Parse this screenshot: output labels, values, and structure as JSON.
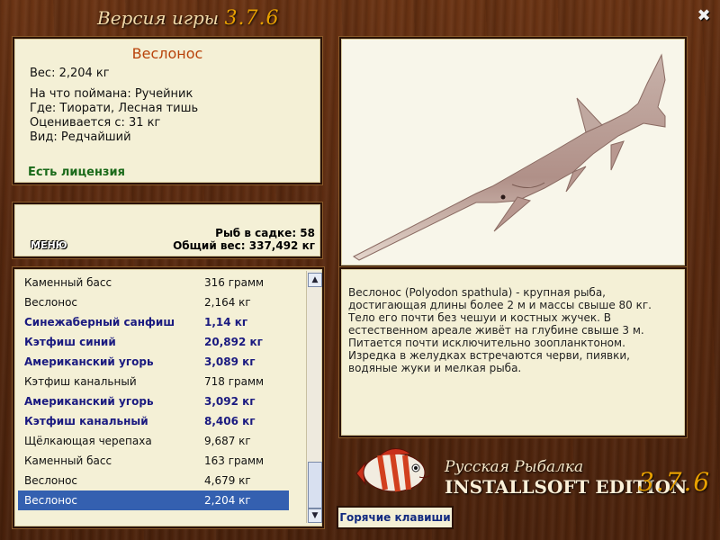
{
  "header": {
    "title_prefix": "Версия игры",
    "version": "3.7.6",
    "close_glyph": "✖"
  },
  "fish_info": {
    "name": "Веслонос",
    "weight": "Вес: 2,204 кг",
    "caught_on": "На что поймана: Ручейник",
    "location": "Где: Тиорати, Лесная тишь",
    "valued_from": "Оценивается с: 31 кг",
    "rarity": "Вид: Редчайший",
    "license": "Есть лицензия"
  },
  "stats": {
    "menu_label": "МЕНЮ",
    "fish_in_cage": "Рыб в садке: 58",
    "total_weight": "Общий вес: 337,492 кг"
  },
  "catch_list": [
    {
      "name": "Каменный басс",
      "weight": "316 грамм",
      "style": "normal"
    },
    {
      "name": "Веслонос",
      "weight": "2,164 кг",
      "style": "normal"
    },
    {
      "name": "Синежаберный санфиш",
      "weight": "1,14 кг",
      "style": "bold"
    },
    {
      "name": "Кэтфиш синий",
      "weight": "20,892 кг",
      "style": "bold"
    },
    {
      "name": "Американский угорь",
      "weight": "3,089 кг",
      "style": "bold"
    },
    {
      "name": "Кэтфиш канальный",
      "weight": "718 грамм",
      "style": "normal"
    },
    {
      "name": "Американский угорь",
      "weight": "3,092 кг",
      "style": "bold"
    },
    {
      "name": "Кэтфиш канальный",
      "weight": "8,406 кг",
      "style": "bold"
    },
    {
      "name": "Щёлкающая черепаха",
      "weight": "9,687 кг",
      "style": "normal"
    },
    {
      "name": "Каменный басс",
      "weight": "163 грамм",
      "style": "normal"
    },
    {
      "name": "Веслонос",
      "weight": "4,679 кг",
      "style": "normal"
    },
    {
      "name": "Веслонос",
      "weight": "2,204 кг",
      "style": "selected"
    }
  ],
  "description": "Веслонос (Polyodon spathula) - крупная рыба, достигающая длины более 2 м и массы свыше 80 кг. Тело его почти без чешуи и костных жучек. В естественном ареале живёт на глубине свыше 3 м. Питается почти исключительно зоопланктоном. Изредка в желудках встречаются черви, пиявки, водяные жуки и мелкая рыба.",
  "branding": {
    "line1": "Русская Рыбалка",
    "line2": "INSTALLSOFT EDITION",
    "version": "3.7.6"
  },
  "hotkeys_label": "Горячие клавиши",
  "colors": {
    "accent": "#e8a000",
    "fish_name": "#b8420a",
    "license": "#1a6a1a",
    "selected_row": "#3460b0"
  }
}
